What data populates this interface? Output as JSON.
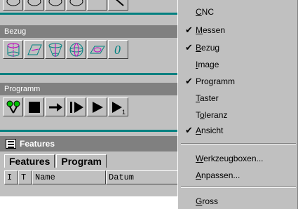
{
  "toolbar_top": {
    "icons": [
      "shape-icon-1",
      "shape-icon-2",
      "shape-icon-3",
      "shape-icon-4",
      "shape-icon-5",
      "tool-icon-6"
    ]
  },
  "bezug": {
    "title": "Bezug",
    "icons": [
      "cylinder-icon",
      "plane-icon",
      "cone-icon",
      "sphere-icon",
      "ellipse-icon",
      "circle-icon"
    ]
  },
  "programm": {
    "title": "Programm",
    "icons": [
      "probe-icon",
      "stop-icon",
      "arrow-right-icon",
      "step-icon",
      "play-icon",
      "play-one-icon"
    ]
  },
  "features": {
    "title": "Features",
    "tabs": [
      "Features",
      "Program"
    ],
    "columns": [
      "I",
      "T",
      "Name",
      "Datum"
    ]
  },
  "menu": {
    "items": [
      {
        "pre": "",
        "u": "C",
        "post": "NC",
        "checked": false
      },
      {
        "pre": "",
        "u": "M",
        "post": "essen",
        "checked": true
      },
      {
        "pre": "",
        "u": "B",
        "post": "ezug",
        "checked": true
      },
      {
        "pre": "",
        "u": "I",
        "post": "mage",
        "checked": false
      },
      {
        "pre": "",
        "u": "",
        "post": "Programm",
        "checked": true
      },
      {
        "pre": "",
        "u": "T",
        "post": "aster",
        "checked": false
      },
      {
        "pre": "T",
        "u": "o",
        "post": "leranz",
        "checked": false
      },
      {
        "pre": "",
        "u": "A",
        "post": "nsicht",
        "checked": true
      },
      {
        "pre": "",
        "u": "W",
        "post": "erkzeugboxen...",
        "checked": false
      },
      {
        "pre": "",
        "u": "A",
        "post": "npassen...",
        "checked": false
      },
      {
        "pre": "",
        "u": "G",
        "post": "ross",
        "checked": false
      }
    ],
    "checkmark": "✔"
  }
}
